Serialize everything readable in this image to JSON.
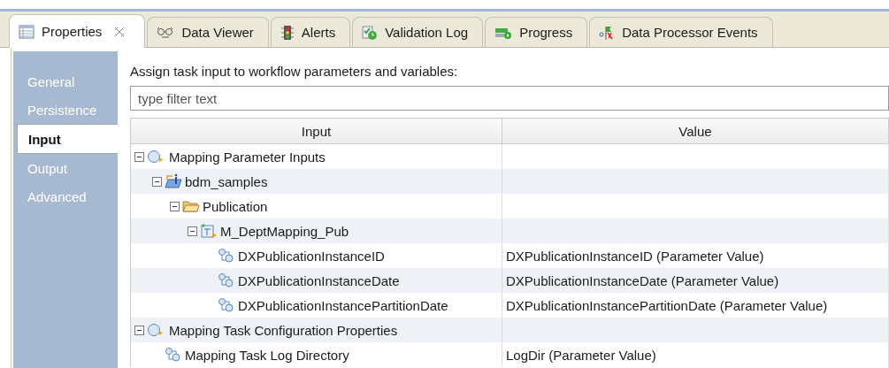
{
  "tabs": [
    {
      "label": "Properties",
      "kind": "table",
      "selected": true,
      "closable": true
    },
    {
      "label": "Data Viewer",
      "kind": "glasses",
      "selected": false,
      "closable": false
    },
    {
      "label": "Alerts",
      "kind": "traffic-light",
      "selected": false,
      "closable": false
    },
    {
      "label": "Validation Log",
      "kind": "check-clock",
      "selected": false,
      "closable": false
    },
    {
      "label": "Progress",
      "kind": "progress",
      "selected": false,
      "closable": false
    },
    {
      "label": "Data Processor Events",
      "kind": "flags",
      "selected": false,
      "closable": false
    }
  ],
  "sidebar": {
    "items": [
      {
        "label": "General",
        "selected": false
      },
      {
        "label": "Persistence",
        "selected": false
      },
      {
        "label": "Input",
        "selected": true
      },
      {
        "label": "Output",
        "selected": false
      },
      {
        "label": "Advanced",
        "selected": false
      }
    ]
  },
  "heading": "Assign task input to workflow parameters and variables:",
  "filter": {
    "placeholder": "type filter text"
  },
  "table": {
    "columns": [
      "Input",
      "Value"
    ],
    "rows": [
      {
        "label": "Mapping Parameter Inputs",
        "kind": "group",
        "expanded": true,
        "children": [
          {
            "label": "bdm_samples",
            "kind": "project",
            "expanded": true,
            "children": [
              {
                "label": "Publication",
                "kind": "folder",
                "expanded": true,
                "children": [
                  {
                    "label": "M_DeptMapping_Pub",
                    "kind": "mapping",
                    "expanded": true,
                    "children": [
                      {
                        "label": "DXPublicationInstanceID",
                        "kind": "parameter",
                        "value": "DXPublicationInstanceID (Parameter Value)"
                      },
                      {
                        "label": "DXPublicationInstanceDate",
                        "kind": "parameter",
                        "value": "DXPublicationInstanceDate (Parameter Value)"
                      },
                      {
                        "label": "DXPublicationInstancePartitionDate",
                        "kind": "parameter",
                        "value": "DXPublicationInstancePartitionDate (Parameter Value)"
                      }
                    ]
                  }
                ]
              }
            ]
          }
        ]
      },
      {
        "label": "Mapping Task Configuration Properties",
        "kind": "group",
        "expanded": true,
        "children": [
          {
            "label": "Mapping Task Log Directory",
            "kind": "parameter",
            "value": "LogDir (Parameter Value)"
          }
        ]
      }
    ]
  }
}
